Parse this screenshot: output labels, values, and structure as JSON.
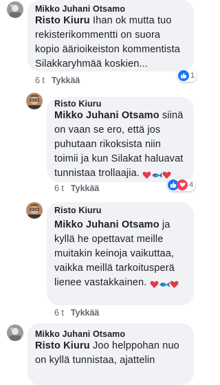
{
  "comments": [
    {
      "author": "Mikko Juhani Otsamo",
      "mention": "Risto Kiuru",
      "text": " Ihan ok mutta tuo\nrekisterikommentti on suora\nkopio äärioikeiston kommentista\nSilakkaryhmää koskien...",
      "time": "6 t",
      "like_label": "Tykkää",
      "reaction_count": "1"
    },
    {
      "author": "Risto Kiuru",
      "mention": "Mikko Juhani Otsamo",
      "text": " siinä\non vaan se ero, että jos\npuhutaan rikoksista niin\ntoimii ja kun Silakat haluavat\ntunnistaa trollaajia.",
      "time": "6 t",
      "like_label": "Tykkää",
      "reaction_count": "4"
    },
    {
      "author": "Risto Kiuru",
      "mention": "Mikko Juhani Otsamo",
      "text": " ja\nkyllä he opettavat meille\nmuitakin keinoja vaikuttaa,\nvaikka meillä tarkoitusperä\nlienee vastakkainen.",
      "time": "6 t",
      "like_label": "Tykkää"
    },
    {
      "author": "Mikko Juhani Otsamo",
      "mention": "Risto Kiuru",
      "text": " Joo helppohan nuo\non kyllä tunnistaa, ajattelin",
      "time": "",
      "like_label": ""
    }
  ],
  "icons": {
    "like": "thumbs-up-icon",
    "heart": "heart-emoji",
    "fish": "fish-emoji"
  },
  "colors": {
    "bubble": "#f0f2f5",
    "like_blue": "#1877f2",
    "meta": "#65676b"
  }
}
